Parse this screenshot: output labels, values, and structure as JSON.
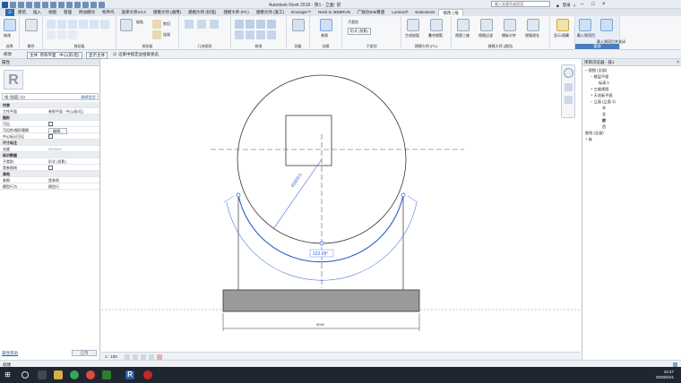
{
  "window": {
    "title": "Autodesk Revit 2018 - 族1 - 立面: 前",
    "search_placeholder": "键入关键字或短语",
    "user": "登录"
  },
  "tabs": [
    "建筑",
    "插入",
    "视图",
    "管理",
    "附加模块",
    "构件坞",
    "族库大师V3.2",
    "建模大师 (通用)",
    "建模大师 (机电)",
    "建模大师 (PC)",
    "建模大师 (施工)",
    "Enscape™",
    "Revit to 3DMRUN",
    "广联达BIM算量",
    "Lumion®",
    "Extensions",
    "修改 | 线"
  ],
  "ribbon": {
    "panels": [
      "选择",
      "属性",
      "剪贴板",
      "几何图形",
      "修改",
      "测量",
      "创建",
      "子类别",
      "建模大师 (PC)",
      "建模大师 (通用)",
      "管理"
    ],
    "buttons": {
      "modify": "修改",
      "properties": "属性",
      "paste": "粘贴",
      "join": "连接",
      "cut": "剪切",
      "measure": "测量",
      "align_ref": "参照",
      "sub_category": "子类别",
      "category_value": "形式 (投影)",
      "gen_wall": "生成剖面",
      "rebar": "叠合钢筋",
      "view_3d": "视图三维",
      "view_filter": "视图过滤",
      "copy_pair": "模板对齐",
      "view_rename": "视图改名",
      "show_hide": "显示/隐藏",
      "load_project": "载入到项目",
      "load_close": "载入到项目并关闭"
    }
  },
  "options_bar": {
    "view": "主体: 参照平面 : 中心(前/后)",
    "display": "显示主体",
    "chain": "沿束中锁定边拾取状态"
  },
  "properties": {
    "header": "属性",
    "family_type": "线 (弧度) (1)",
    "edit_type": "编辑类型",
    "rows": [
      {
        "k": "约束",
        "v": "",
        "group": true
      },
      {
        "k": "工作平面",
        "v": "参照平面 : 中心(前/后)"
      },
      {
        "k": "图形",
        "v": "",
        "group": true
      },
      {
        "k": "可见",
        "v": "",
        "check": true
      },
      {
        "k": "可见性/图形替换",
        "v": "编辑..."
      },
      {
        "k": "中心标记可见",
        "v": "",
        "check": true
      },
      {
        "k": "尺寸标注",
        "v": "",
        "group": true
      },
      {
        "k": "长度",
        "v": "65234.8"
      },
      {
        "k": "标识数据",
        "v": "",
        "group": true
      },
      {
        "k": "子类别",
        "v": "形式 (投影)"
      },
      {
        "k": "是参照线",
        "v": "",
        "check": true
      },
      {
        "k": "其他",
        "v": "",
        "group": true
      },
      {
        "k": "参照",
        "v": "是参照"
      },
      {
        "k": "模型行为",
        "v": "模型行"
      }
    ],
    "help_link": "属性帮助",
    "apply": "应用"
  },
  "canvas": {
    "radius_label": "40000.0",
    "angle_label": "122.09°",
    "dim_label": "5090"
  },
  "browser": {
    "header": "项目浏览器 - 族1",
    "nodes": [
      {
        "label": "视图 (全部)",
        "level": 0,
        "exp": "−"
      },
      {
        "label": "楼层平面",
        "level": 1,
        "exp": "−"
      },
      {
        "label": "标高 1",
        "level": 2,
        "exp": ""
      },
      {
        "label": "三维视图",
        "level": 1,
        "exp": "+"
      },
      {
        "label": "天花板平面",
        "level": 1,
        "exp": "+"
      },
      {
        "label": "立面 (立面 1)",
        "level": 1,
        "exp": "−"
      },
      {
        "label": "东",
        "level": 2,
        "exp": ""
      },
      {
        "label": "北",
        "level": 2,
        "exp": ""
      },
      {
        "label": "前",
        "level": 2,
        "exp": ""
      },
      {
        "label": "西",
        "level": 2,
        "exp": ""
      },
      {
        "label": "图纸 (全部)",
        "level": 0,
        "exp": ""
      },
      {
        "label": "族",
        "level": 0,
        "exp": "+"
      }
    ]
  },
  "viewbar": {
    "scale": "1 : 100"
  },
  "status": {
    "text": "就绪"
  },
  "taskbar": {
    "time": "10:47",
    "date": "2020/5/21"
  }
}
